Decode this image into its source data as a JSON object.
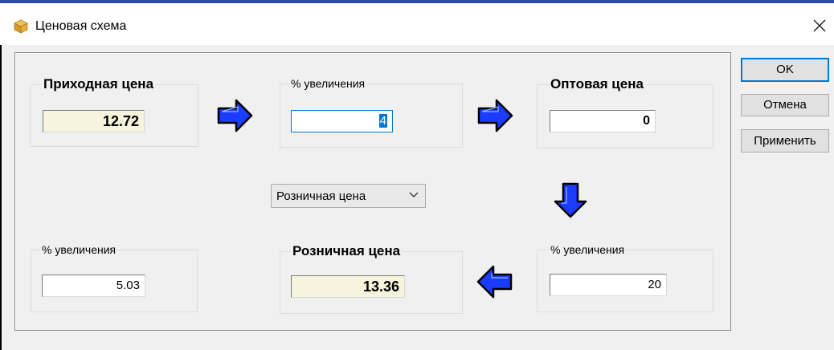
{
  "window": {
    "title": "Ценовая схема",
    "close_symbol": "✕"
  },
  "purchase": {
    "label": "Приходная цена",
    "value": "12.72"
  },
  "markup_top": {
    "label": "% увеличения",
    "value": "4"
  },
  "wholesale": {
    "label": "Оптовая цена",
    "value": "0"
  },
  "price_type_select": {
    "selected": "Розничная цена"
  },
  "markup_left": {
    "label": "% увеличения",
    "value": "5.03"
  },
  "retail": {
    "label": "Розничная цена",
    "value": "13.36"
  },
  "markup_right": {
    "label": "% увеличения",
    "value": "20"
  },
  "buttons": {
    "ok": "OK",
    "cancel": "Отмена",
    "apply": "Применить"
  },
  "icons": {
    "app": "package-icon",
    "arrows": [
      "arrow-right-icon",
      "arrow-right-icon",
      "arrow-down-icon",
      "arrow-left-icon"
    ],
    "dropdown": "chevron-down-icon"
  },
  "colors": {
    "arrow_fill": "#1a3cff",
    "readonly_field": "#f6f4dd",
    "focus_border": "#0078d7"
  }
}
